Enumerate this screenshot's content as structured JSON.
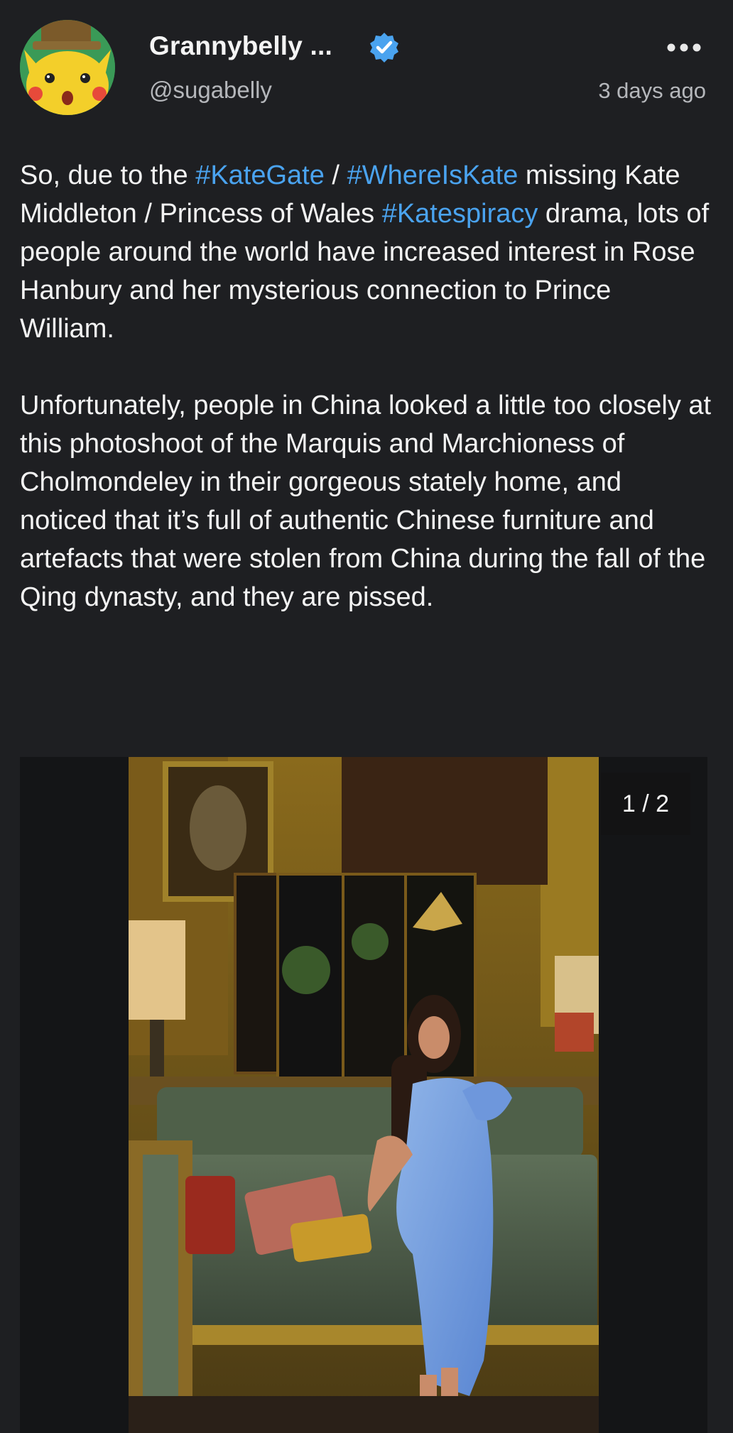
{
  "post": {
    "author": {
      "display_name": "Grannybelly ...",
      "handle": "@sugabelly",
      "verified": true,
      "avatar_icon": "pikachu-avatar-icon"
    },
    "timestamp": "3 days ago",
    "more_icon": "more-dots-icon",
    "paragraphs": [
      [
        {
          "text": "So, due to the ",
          "hashtag": false
        },
        {
          "text": "#KateGate",
          "hashtag": true
        },
        {
          "text": " / ",
          "hashtag": false
        },
        {
          "text": "#WhereIsKate",
          "hashtag": true
        },
        {
          "text": " missing Kate Middleton / Princess of Wales ",
          "hashtag": false
        },
        {
          "text": "#Katespiracy",
          "hashtag": true
        },
        {
          "text": " drama, lots of people around the world have increased interest in Rose Hanbury and her mysterious connection to Prince William.",
          "hashtag": false
        }
      ],
      [
        {
          "text": "Unfortunately, people in China looked a little too closely at this photoshoot of the Marquis and Marchioness of Cholmondeley in their gorgeous stately home, and noticed that it’s full of authentic Chinese furniture and artefacts that were stolen from China during the fall of the Qing dynasty, and they are pissed.",
          "hashtag": false
        }
      ]
    ],
    "media": {
      "counter": "1 / 2",
      "image_icon": "photo-woman-on-sofa-image"
    }
  },
  "colors": {
    "background": "#1e1f22",
    "text": "#f3f3f3",
    "muted": "#b5b7bb",
    "hashtag": "#4aa3ef",
    "verified_badge": "#4aa3ef"
  }
}
